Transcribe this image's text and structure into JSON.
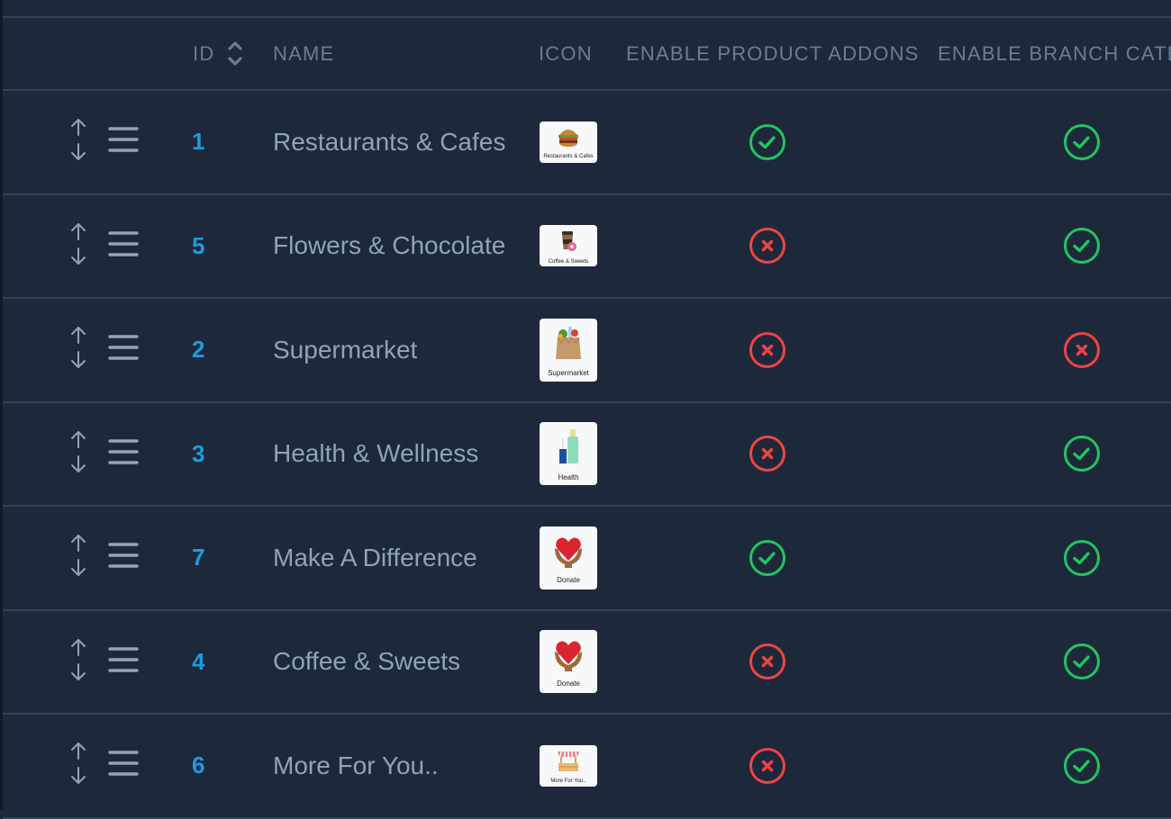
{
  "colors": {
    "background": "#1d283a",
    "divider": "#334155",
    "header_text": "#6b7d96",
    "name_text": "#8fa3bc",
    "id_text": "#1e9ce0",
    "enabled": "#22c55e",
    "disabled": "#ef4444"
  },
  "table": {
    "columns": [
      {
        "key": "id",
        "label": "ID",
        "sortable": true
      },
      {
        "key": "name",
        "label": "NAME"
      },
      {
        "key": "icon",
        "label": "ICON"
      },
      {
        "key": "enable_product_addons",
        "label": "ENABLE PRODUCT ADDONS"
      },
      {
        "key": "enable_branch_categories",
        "label": "ENABLE BRANCH CATEG"
      }
    ],
    "rows": [
      {
        "id": "1",
        "name": "Restaurants & Cafes",
        "icon": {
          "kind": "burger",
          "caption": "Restaurants & Cafes",
          "size": "short"
        },
        "enable_product_addons": true,
        "enable_branch_categories": true
      },
      {
        "id": "5",
        "name": "Flowers & Chocolate",
        "icon": {
          "kind": "coffee",
          "caption": "Coffee & Sweets",
          "size": "short"
        },
        "enable_product_addons": false,
        "enable_branch_categories": true
      },
      {
        "id": "2",
        "name": "Supermarket",
        "icon": {
          "kind": "grocery-bag",
          "caption": "Supermarket",
          "size": "tall"
        },
        "enable_product_addons": false,
        "enable_branch_categories": false
      },
      {
        "id": "3",
        "name": "Health & Wellness",
        "icon": {
          "kind": "bottles",
          "caption": "Health",
          "size": "tall"
        },
        "enable_product_addons": false,
        "enable_branch_categories": true
      },
      {
        "id": "7",
        "name": "Make A Difference",
        "icon": {
          "kind": "heart-hands",
          "caption": "Donate",
          "size": "tall"
        },
        "enable_product_addons": true,
        "enable_branch_categories": true
      },
      {
        "id": "4",
        "name": "Coffee & Sweets",
        "icon": {
          "kind": "heart-hands",
          "caption": "Donate",
          "size": "tall"
        },
        "enable_product_addons": false,
        "enable_branch_categories": true
      },
      {
        "id": "6",
        "name": "More For You..",
        "icon": {
          "kind": "market-stall",
          "caption": "More For You..",
          "size": "short"
        },
        "enable_product_addons": false,
        "enable_branch_categories": true
      }
    ]
  },
  "icons": {
    "move": "up-down-arrow-icon",
    "drag": "drag-handle-icon",
    "sort": "sort-icon",
    "enabled": "check-circle-icon",
    "disabled": "x-circle-icon"
  }
}
